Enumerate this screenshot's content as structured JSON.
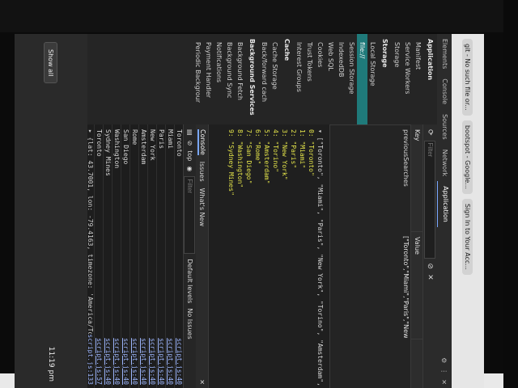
{
  "browser": {
    "tabs": [
      "git - No such file or...",
      "bootspot - Google...",
      "Sign In to Your Acc..."
    ]
  },
  "devtools": {
    "tabs": [
      "Elements",
      "Console",
      "Sources",
      "Network",
      "Application"
    ],
    "active_tab": "Application",
    "sidebar": {
      "application_title": "Application",
      "application_items": [
        "Manifest",
        "Service Workers",
        "Storage"
      ],
      "storage_title": "Storage",
      "storage_items": [
        "Local Storage",
        "file://",
        "Session Storage",
        "IndexedDB",
        "Web SQL",
        "Cookies",
        "Trust Tokens",
        "Interest Groups"
      ],
      "cache_title": "Cache",
      "cache_items": [
        "Cache Storage",
        "Back/forward cach"
      ],
      "background_title": "Background Services",
      "background_items": [
        "Background Fetch",
        "Background Sync",
        "Notifications",
        "Payment Handler",
        "Periodic Backgrour"
      ]
    },
    "storage_view": {
      "filter_placeholder": "Filter",
      "col_key": "Key",
      "col_value": "Value",
      "row_key": "previousSearches",
      "row_value": "[\"Toronto\",\"Miami\",\"Paris\",\"New York\"..."
    },
    "preview": {
      "summary": "▾ [\"Toronto\", \"Miami\", \"Paris\", \"New York\", \"Torino\", \"Amsterdam\",",
      "items": [
        "0: \"Toronto\"",
        "1: \"Miami\"",
        "2: \"Paris\"",
        "3: \"New York\"",
        "4: \"Torino\"",
        "5: \"Amsterdam\"",
        "6: \"Rome\"",
        "7: \"San Diego\"",
        "8: \"Washington\"",
        "9: \"Sydney Mines\""
      ]
    },
    "drawer": {
      "tabs": [
        "Console",
        "Issues",
        "What's New"
      ],
      "active": "Console",
      "context": "top",
      "filter_placeholder": "Filter",
      "levels": "Default levels",
      "issues": "No Issues"
    },
    "console_logs": [
      {
        "text": "Toronto",
        "src": "script.js:40"
      },
      {
        "text": "Miami",
        "src": "script.js:40"
      },
      {
        "text": "Paris",
        "src": "script.js:40"
      },
      {
        "text": "New York",
        "src": "script.js:40"
      },
      {
        "text": "Amsterdam",
        "src": "script.js:40"
      },
      {
        "text": "Rome",
        "src": "script.js:40"
      },
      {
        "text": "San Diego",
        "src": "script.js:40"
      },
      {
        "text": "Washington",
        "src": "script.js:40"
      },
      {
        "text": "Sydney Mines",
        "src": "script.js:40"
      },
      {
        "text": "Toronto",
        "src": "script.js:57"
      }
    ],
    "console_object": "▸ {lat: 43.7001, lon: -79.4163, timezone: 'America/Toronto', timezone_offset: -14",
    "console_object_src": "script.js:133"
  },
  "taskbar": {
    "show_all": "Show all",
    "time": "11:19 pm"
  }
}
